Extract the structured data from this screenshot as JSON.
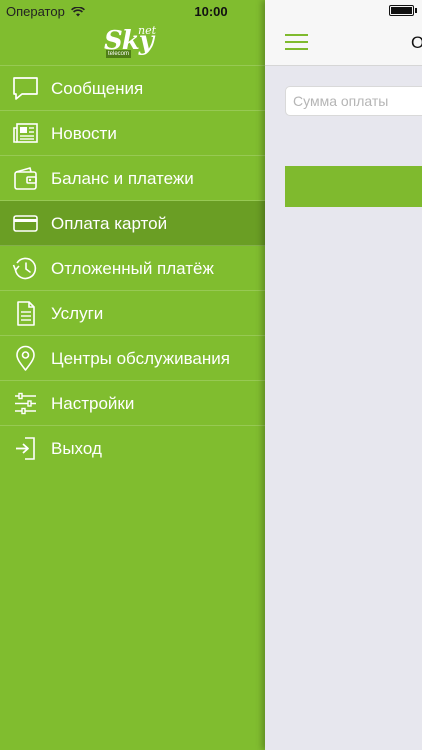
{
  "statusbar": {
    "carrier": "Оператор",
    "time": "10:00"
  },
  "sidebar": {
    "logo": {
      "main": "Sky",
      "super": "net",
      "sub": "telecom"
    },
    "items": [
      {
        "label": "Сообщения",
        "icon": "chat-icon"
      },
      {
        "label": "Новости",
        "icon": "newspaper-icon"
      },
      {
        "label": "Баланс и платежи",
        "icon": "wallet-icon"
      },
      {
        "label": "Оплата картой",
        "icon": "credit-card-icon",
        "active": true
      },
      {
        "label": "Отложенный платёж",
        "icon": "history-clock-icon"
      },
      {
        "label": "Услуги",
        "icon": "document-icon"
      },
      {
        "label": "Центры обслуживания",
        "icon": "map-pin-icon"
      },
      {
        "label": "Настройки",
        "icon": "sliders-icon"
      },
      {
        "label": "Выход",
        "icon": "logout-icon"
      }
    ]
  },
  "main": {
    "title_fragment": "О",
    "amount_placeholder": "Сумма оплаты",
    "accent_color": "#7fba2e"
  }
}
